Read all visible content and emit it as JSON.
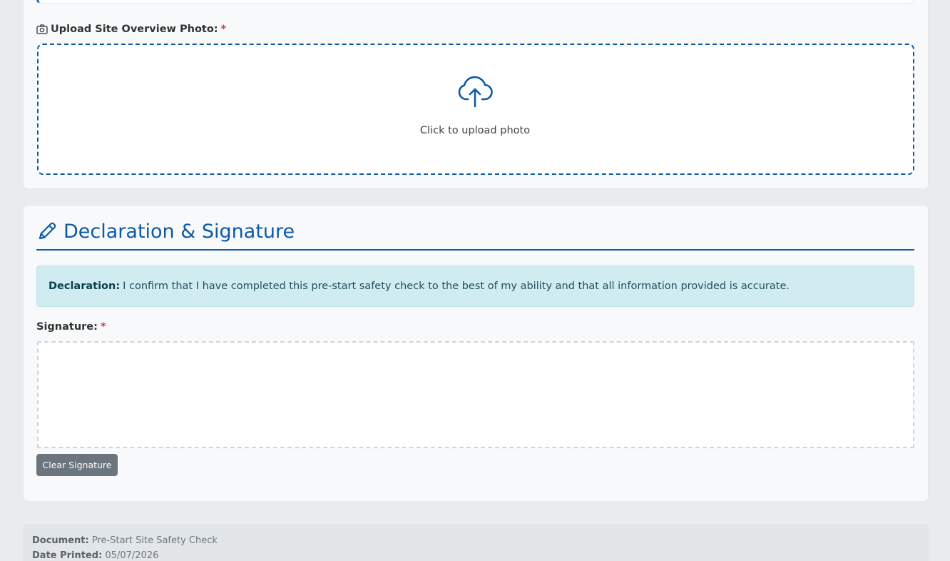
{
  "photo_upload": {
    "label": "Upload Site Overview Photo:",
    "required_marker": "*",
    "zone_text": "Click to upload photo",
    "icon": "camera-icon",
    "zone_icon": "cloud-upload-icon"
  },
  "declaration": {
    "title": "Declaration & Signature",
    "title_icon": "pencil-icon",
    "label": "Declaration:",
    "text": "I confirm that I have completed this pre-start safety check to the best of my ability and that all information provided is accurate."
  },
  "signature": {
    "label": "Signature:",
    "required_marker": "*",
    "clear_button": "Clear Signature"
  },
  "footer": {
    "document_label": "Document:",
    "document_value": "Pre-Start Site Safety Check",
    "date_label": "Date Printed:",
    "date_value": "05/07/2026"
  },
  "colors": {
    "accent": "#0d5aa7",
    "required": "#dc3545",
    "info_bg": "#d1ecf1",
    "button": "#6c757d"
  }
}
